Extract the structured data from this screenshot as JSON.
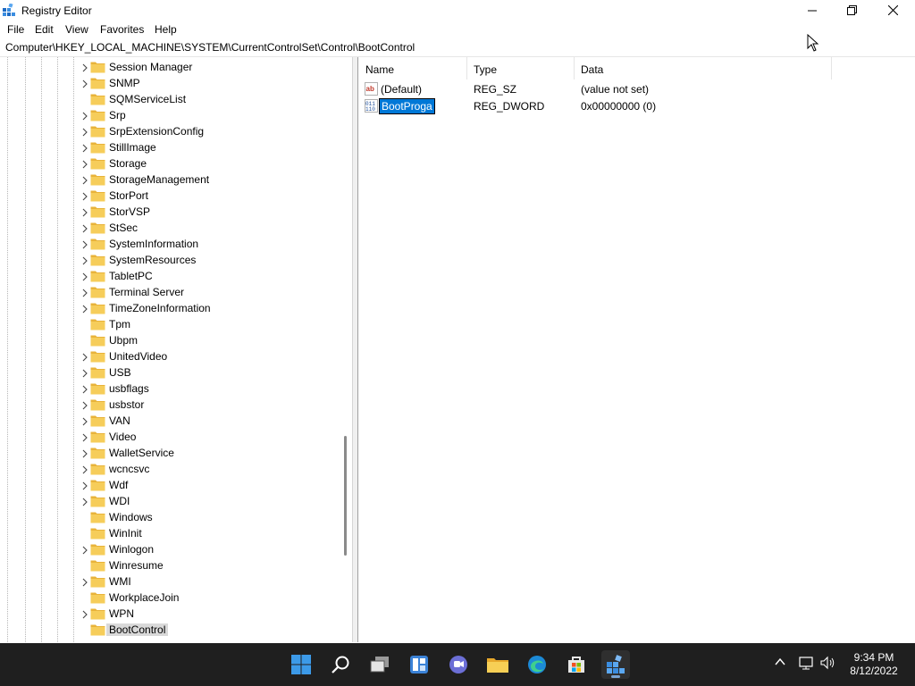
{
  "window": {
    "title": "Registry Editor"
  },
  "menu": [
    "File",
    "Edit",
    "View",
    "Favorites",
    "Help"
  ],
  "address": "Computer\\HKEY_LOCAL_MACHINE\\SYSTEM\\CurrentControlSet\\Control\\BootControl",
  "tree": {
    "items": [
      {
        "label": "Session Manager",
        "expandable": true
      },
      {
        "label": "SNMP",
        "expandable": true
      },
      {
        "label": "SQMServiceList",
        "expandable": false
      },
      {
        "label": "Srp",
        "expandable": true
      },
      {
        "label": "SrpExtensionConfig",
        "expandable": true
      },
      {
        "label": "StillImage",
        "expandable": true
      },
      {
        "label": "Storage",
        "expandable": true
      },
      {
        "label": "StorageManagement",
        "expandable": true
      },
      {
        "label": "StorPort",
        "expandable": true
      },
      {
        "label": "StorVSP",
        "expandable": true
      },
      {
        "label": "StSec",
        "expandable": true
      },
      {
        "label": "SystemInformation",
        "expandable": true
      },
      {
        "label": "SystemResources",
        "expandable": true
      },
      {
        "label": "TabletPC",
        "expandable": true
      },
      {
        "label": "Terminal Server",
        "expandable": true
      },
      {
        "label": "TimeZoneInformation",
        "expandable": true
      },
      {
        "label": "Tpm",
        "expandable": false
      },
      {
        "label": "Ubpm",
        "expandable": false
      },
      {
        "label": "UnitedVideo",
        "expandable": true
      },
      {
        "label": "USB",
        "expandable": true
      },
      {
        "label": "usbflags",
        "expandable": true
      },
      {
        "label": "usbstor",
        "expandable": true
      },
      {
        "label": "VAN",
        "expandable": true
      },
      {
        "label": "Video",
        "expandable": true
      },
      {
        "label": "WalletService",
        "expandable": true
      },
      {
        "label": "wcncsvc",
        "expandable": true
      },
      {
        "label": "Wdf",
        "expandable": true
      },
      {
        "label": "WDI",
        "expandable": true
      },
      {
        "label": "Windows",
        "expandable": false
      },
      {
        "label": "WinInit",
        "expandable": false
      },
      {
        "label": "Winlogon",
        "expandable": true
      },
      {
        "label": "Winresume",
        "expandable": false
      },
      {
        "label": "WMI",
        "expandable": true
      },
      {
        "label": "WorkplaceJoin",
        "expandable": false
      },
      {
        "label": "WPN",
        "expandable": true
      },
      {
        "label": "BootControl",
        "expandable": false,
        "selected": true
      }
    ]
  },
  "list": {
    "columns": [
      "Name",
      "Type",
      "Data"
    ],
    "rows": [
      {
        "icon": "string-value-icon",
        "name": "(Default)",
        "type": "REG_SZ",
        "data": "(value not set)"
      },
      {
        "icon": "dword-value-icon",
        "name": "BootProga",
        "type": "REG_DWORD",
        "data": "0x00000000 (0)",
        "editing": true
      }
    ]
  },
  "taskbar": {
    "icons": [
      "start-icon",
      "search-icon",
      "task-view-icon",
      "widgets-icon",
      "chat-icon",
      "file-explorer-icon",
      "edge-icon",
      "store-icon",
      "registry-editor-icon"
    ],
    "active": "registry-editor-icon",
    "tray_icons": [
      "chevron-up-icon",
      "network-icon",
      "volume-icon"
    ],
    "time": "9:34 PM",
    "date": "8/12/2022"
  },
  "colors": {
    "selection": "#0078d7",
    "taskbar": "#1f1f1f",
    "folder": "#f4c542"
  }
}
